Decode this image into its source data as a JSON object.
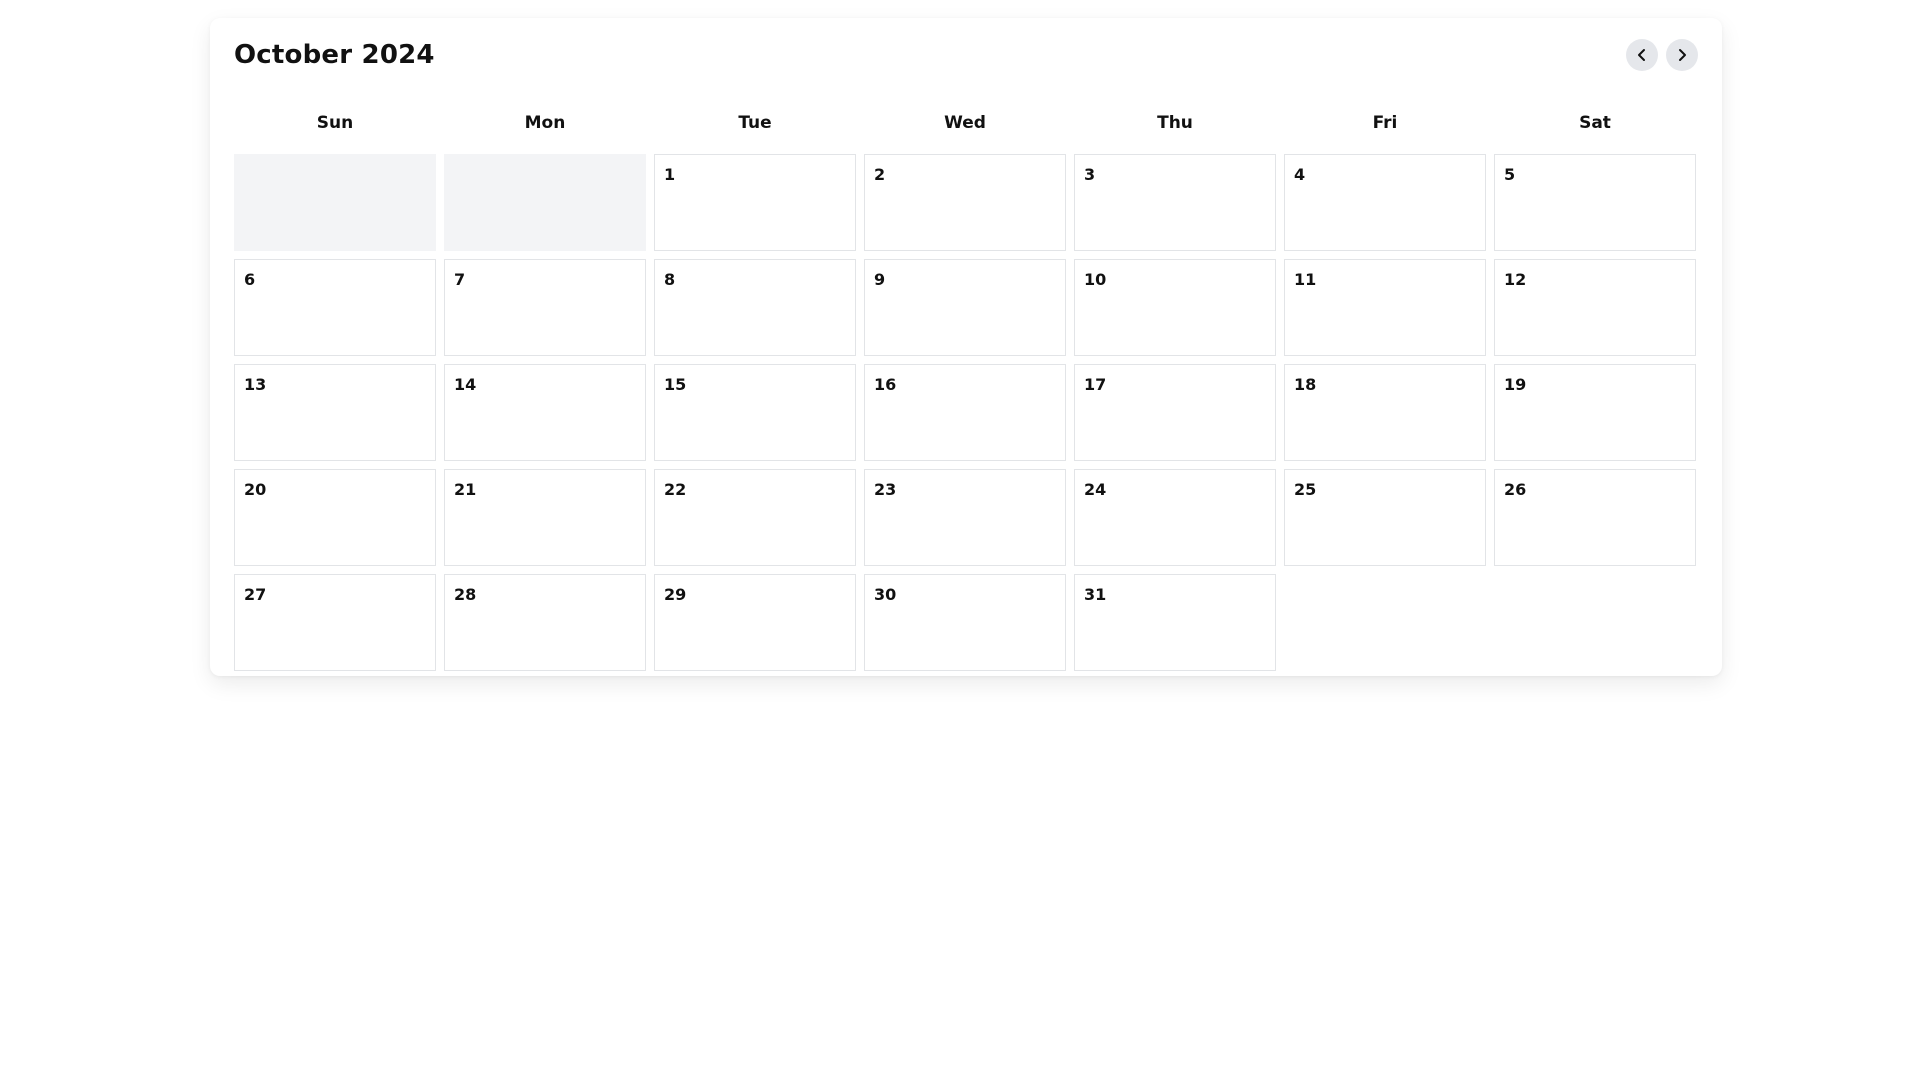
{
  "calendar": {
    "title": "October 2024",
    "weekdays": [
      "Sun",
      "Mon",
      "Tue",
      "Wed",
      "Thu",
      "Fri",
      "Sat"
    ],
    "leading_empty_days": 2,
    "days": [
      "1",
      "2",
      "3",
      "4",
      "5",
      "6",
      "7",
      "8",
      "9",
      "10",
      "11",
      "12",
      "13",
      "14",
      "15",
      "16",
      "17",
      "18",
      "19",
      "20",
      "21",
      "22",
      "23",
      "24",
      "25",
      "26",
      "27",
      "28",
      "29",
      "30",
      "31"
    ],
    "nav": {
      "prev_icon": "chevron-left-icon",
      "next_icon": "chevron-right-icon"
    },
    "colors": {
      "empty_cell": "#f3f4f6",
      "nav_button": "#e5e7eb",
      "cell_border": "#e2e4e7"
    }
  }
}
